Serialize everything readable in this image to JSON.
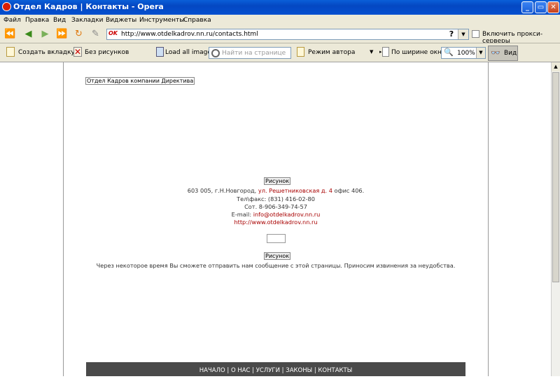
{
  "window": {
    "title": "Отдел Кадров | Контакты - Opera",
    "min_label": "_",
    "max_label": "▭",
    "close_label": "✕"
  },
  "menu": [
    "Файл",
    "Правка",
    "Вид",
    "Закладки",
    "Виджеты",
    "Инструменты",
    "Справка"
  ],
  "address": {
    "ok_badge": "OK",
    "url": "http://www.otdelkadrov.nn.ru/contacts.html",
    "help": "?",
    "proxy_label": "Включить прокси-серверы"
  },
  "toolbar": {
    "new_tab": "Создать вкладку",
    "no_images": "Без рисунков",
    "load_images": "Load all images",
    "find_placeholder": "Найти на странице",
    "author_mode": "Режим автора",
    "fit_width": "По ширине окна",
    "zoom": "100%",
    "view": "Вид"
  },
  "page": {
    "brand": "Отдел Кадров компании Директива",
    "pic1": "Рисунок",
    "address_prefix": "603 005, г.Н.Новгород, ",
    "address_street": "ул. Решетниковская д. 4",
    "address_suffix": " офис 406.",
    "telfax": "Тел\\факс: (831) 416-02-80",
    "mobile": "Сот. 8-906-349-74-57",
    "email_label": "E-mail: ",
    "email": "info@otdelkadrov.nn.ru",
    "site": "http://www.otdelkadrov.nn.ru",
    "pic2": "Рисунок",
    "notice": "Через некоторое время Вы сможете отправить нам сообщение с этой страницы. Приносим извинения за неудобства.",
    "footer": "НАЧАЛО | О НАС | УСЛУГИ | ЗАКОНЫ | КОНТАКТЫ"
  },
  "colors": {
    "titlebar": "#0450d0",
    "chrome": "#ece9d8",
    "link": "#a80000",
    "footer": "#4a4a4a"
  }
}
